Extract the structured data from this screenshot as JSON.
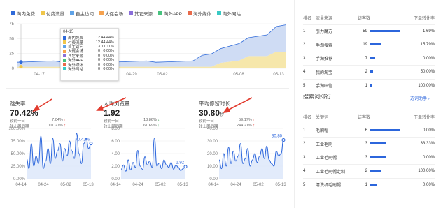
{
  "legend": [
    {
      "label": "淘内免费",
      "color": "#2f6ad9"
    },
    {
      "label": "付费流量",
      "color": "#f0c64a"
    },
    {
      "label": "自主访问",
      "color": "#5fa3e8"
    },
    {
      "label": "大促会场",
      "color": "#f6a24e"
    },
    {
      "label": "其它来源",
      "color": "#8a6ed9"
    },
    {
      "label": "淘外APP",
      "color": "#47c27e"
    },
    {
      "label": "淘外媒体",
      "color": "#e86a4a"
    },
    {
      "label": "淘外网站",
      "color": "#39c9c4"
    }
  ],
  "main_chart": {
    "y_ticks": [
      "75",
      "50",
      "25",
      "0"
    ],
    "x_ticks": [
      "04-17",
      "04-21",
      "04-29",
      "05-02",
      "05-08",
      "05-13"
    ]
  },
  "tooltip": {
    "date": "04-15",
    "rows": [
      {
        "name": "淘内免费",
        "count": "12",
        "pct": "44.44%",
        "color": "#2f6ad9"
      },
      {
        "name": "付费流量",
        "count": "12",
        "pct": "44.44%",
        "color": "#f0c64a"
      },
      {
        "name": "自主访问",
        "count": "3",
        "pct": "11.11%",
        "color": "#5fa3e8"
      },
      {
        "name": "大促会场",
        "count": "0",
        "pct": "0.00%",
        "color": "#f6a24e"
      },
      {
        "name": "其它来源",
        "count": "0",
        "pct": "0.00%",
        "color": "#8a6ed9"
      },
      {
        "name": "淘外APP",
        "count": "0",
        "pct": "0.00%",
        "color": "#47c27e"
      },
      {
        "name": "淘外媒体",
        "count": "0",
        "pct": "0.00%",
        "color": "#e86a4a"
      },
      {
        "name": "淘外网站",
        "count": "0",
        "pct": "0.00%",
        "color": "#39c9c4"
      }
    ]
  },
  "kpis": [
    {
      "label": "跳失率",
      "value": "70.42%",
      "unit": "",
      "prev_day_label": "较前一日",
      "prev_day": "7.04%",
      "prev_day_dir": "up",
      "prev_period_label": "较上周同期",
      "prev_period": "111.27%",
      "prev_period_dir": "up"
    },
    {
      "label": "人均浏览量",
      "value": "1.92",
      "unit": "",
      "prev_day_label": "较前一日",
      "prev_day": "13.86%",
      "prev_day_dir": "down",
      "prev_period_label": "较上周同期",
      "prev_period": "61.69%",
      "prev_period_dir": "down"
    },
    {
      "label": "平均停留时长",
      "value": "30.80",
      "unit": "秒",
      "prev_day_label": "较前一日",
      "prev_day": "59.17%",
      "prev_day_dir": "up",
      "prev_period_label": "较上周同期",
      "prev_period": "244.21%",
      "prev_period_dir": "up"
    }
  ],
  "mini_charts": [
    {
      "y_ticks": [
        "100.00%",
        "75.00%",
        "50.00%",
        "25.00%",
        "0.00%"
      ],
      "x_ticks": [
        "04-14",
        "04-24",
        "05-02",
        "05-13"
      ],
      "last_label": "70.42%",
      "values": [
        40,
        20,
        70,
        25,
        45,
        30,
        85,
        20,
        35,
        60,
        30,
        80,
        40,
        55,
        70,
        35,
        60,
        45,
        75,
        55,
        40,
        90,
        50,
        30,
        70,
        80,
        60,
        70
      ]
    },
    {
      "y_ticks": [
        "8.00",
        "6.00",
        "4.00",
        "2.00",
        "0.00"
      ],
      "x_ticks": [
        "04-14",
        "04-24",
        "05-02",
        "05-13"
      ],
      "last_label": "1.92",
      "values": [
        1.5,
        2.2,
        1.2,
        3.0,
        1.4,
        2.6,
        1.8,
        4.5,
        2.0,
        1.5,
        3.5,
        2.2,
        2.8,
        1.8,
        6.5,
        2.0,
        2.5,
        1.6,
        3.0,
        2.2,
        1.8,
        2.6,
        1.5,
        2.2,
        1.8,
        1.3,
        1.6,
        1.92
      ]
    },
    {
      "y_ticks": [
        "40.00",
        "30.00",
        "20.00",
        "10.00",
        "0.00"
      ],
      "x_ticks": [
        "04-14",
        "04-24",
        "05-02",
        "05-13"
      ],
      "last_label": "30.80",
      "values": [
        15,
        8,
        20,
        10,
        25,
        12,
        22,
        14,
        18,
        28,
        12,
        16,
        24,
        10,
        15,
        20,
        13,
        18,
        24,
        16,
        26,
        15,
        12,
        10,
        22,
        18,
        20,
        30.8
      ]
    }
  ],
  "source_table": {
    "headers": [
      "排名",
      "流量来源",
      "访客数",
      "下单转化率"
    ],
    "rows": [
      {
        "rank": "1",
        "name": "引力魔方",
        "visitors": "59",
        "bar": 1.0,
        "rate": "1.69%"
      },
      {
        "rank": "2",
        "name": "手淘搜索",
        "visitors": "19",
        "bar": 0.32,
        "rate": "15.79%"
      },
      {
        "rank": "3",
        "name": "手淘推荐",
        "visitors": "7",
        "bar": 0.12,
        "rate": "0.00%"
      },
      {
        "rank": "4",
        "name": "我的淘宝",
        "visitors": "2",
        "bar": 0.04,
        "rate": "50.00%"
      },
      {
        "rank": "5",
        "name": "手淘旺信",
        "visitors": "1",
        "bar": 0.02,
        "rate": "100.00%"
      }
    ]
  },
  "search_section": {
    "title": "搜索词排行",
    "link": "选词助手 ›"
  },
  "search_table": {
    "headers": [
      "排名",
      "关键词",
      "访客数",
      "下单转化率"
    ],
    "rows": [
      {
        "rank": "1",
        "name": "毛刷帽",
        "visitors": "6",
        "bar": 1.0,
        "rate": "0.00%"
      },
      {
        "rank": "2",
        "name": "工业毛刷",
        "visitors": "3",
        "bar": 0.5,
        "rate": "33.33%"
      },
      {
        "rank": "3",
        "name": "工业毛刷帽",
        "visitors": "3",
        "bar": 0.5,
        "rate": "0.00%"
      },
      {
        "rank": "4",
        "name": "工业毛刷帽定制",
        "visitors": "2",
        "bar": 0.33,
        "rate": "100.00%"
      },
      {
        "rank": "5",
        "name": "清洗机毛刷帽",
        "visitors": "1",
        "bar": 0.17,
        "rate": "0.00%"
      }
    ]
  }
}
